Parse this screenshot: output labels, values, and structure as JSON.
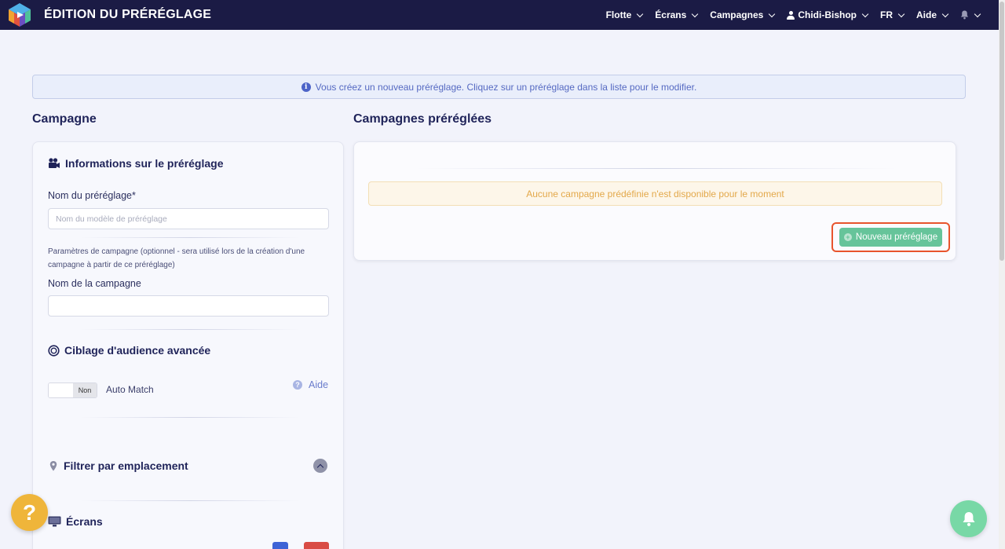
{
  "app": {
    "title": "ÉDITION DU PRÉRÉGLAGE"
  },
  "nav": {
    "items": [
      {
        "label": "Flotte"
      },
      {
        "label": "Écrans"
      },
      {
        "label": "Campagnes"
      },
      {
        "label": "Chidi-Bishop",
        "icon": "user-icon"
      },
      {
        "label": "FR"
      },
      {
        "label": "Aide"
      },
      {
        "label": "",
        "icon": "bell-icon"
      }
    ]
  },
  "banner": {
    "text": "Vous créez un nouveau préréglage. Cliquez sur un préréglage dans la liste pour le modifier.",
    "icon": "info-icon"
  },
  "left": {
    "section_title": "Campagne",
    "info_heading": "Informations sur le préréglage",
    "preset_name_label": "Nom du préréglage*",
    "preset_name_placeholder": "Nom du modèle de préréglage",
    "preset_name_value": "",
    "campaign_params_help": "Paramètres de campagne (optionnel - sera utilisé lors de la création d'une campagne à partir de ce préréglage)",
    "campaign_name_label": "Nom de la campagne",
    "campaign_name_value": "",
    "audience_heading": "Ciblage d'audience avancée",
    "toggle_state": "Non",
    "auto_match_label": "Auto Match",
    "help_label": "Aide",
    "location_heading": "Filtrer par emplacement",
    "screens_heading": "Écrans"
  },
  "right": {
    "section_title": "Campagnes préréglées",
    "empty_message": "Aucune campagne prédéfinie n'est disponible pour le moment",
    "new_preset_label": "Nouveau préréglage"
  },
  "fab": {
    "help_glyph": "?"
  },
  "colors": {
    "navbar": "#1b1b45",
    "accent_green": "#66c49a",
    "highlight": "#e8542d",
    "warning_text": "#e3a84a",
    "help_fab": "#efb53a",
    "bell_fab": "#78d8a6"
  }
}
